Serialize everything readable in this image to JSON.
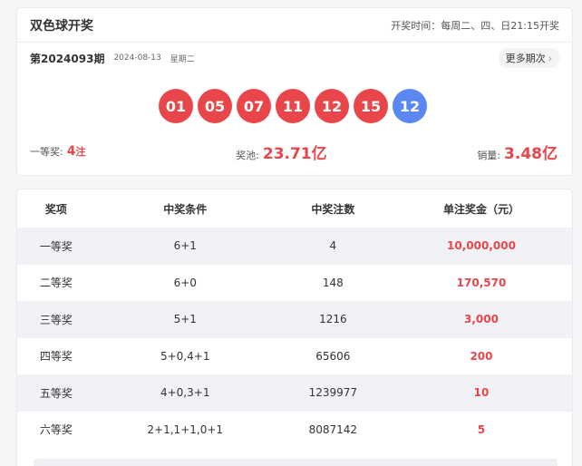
{
  "header": {
    "title": "双色球开奖",
    "schedule": "开奖时间：每周二、四、日21:15开奖"
  },
  "draw": {
    "issue": "第2024093期",
    "date": "2024-08-13",
    "weekday": "星期二",
    "more_label": "更多期次"
  },
  "balls": {
    "red": [
      "01",
      "05",
      "07",
      "11",
      "12",
      "15"
    ],
    "blue": [
      "12"
    ]
  },
  "stats": {
    "first_prize_label": "一等奖:",
    "first_prize_value": "4",
    "first_prize_unit": "注",
    "pool_label": "奖池:",
    "pool_value": "23.71亿",
    "sales_label": "销量:",
    "sales_value": "3.48亿"
  },
  "colors": {
    "red_ball": "#e8464a",
    "blue_ball": "#5b87f2",
    "accent": "#e8464a"
  },
  "table": {
    "headers": [
      "奖项",
      "中奖条件",
      "中奖注数",
      "单注奖金（元）"
    ],
    "rows": [
      [
        "一等奖",
        "6+1",
        "4",
        "10,000,000"
      ],
      [
        "二等奖",
        "6+0",
        "148",
        "170,570"
      ],
      [
        "三等奖",
        "5+1",
        "1216",
        "3,000"
      ],
      [
        "四等奖",
        "5+0,4+1",
        "65606",
        "200"
      ],
      [
        "五等奖",
        "4+0,3+1",
        "1239977",
        "10"
      ],
      [
        "六等奖",
        "2+1,1+1,0+1",
        "8087142",
        "5"
      ]
    ]
  }
}
